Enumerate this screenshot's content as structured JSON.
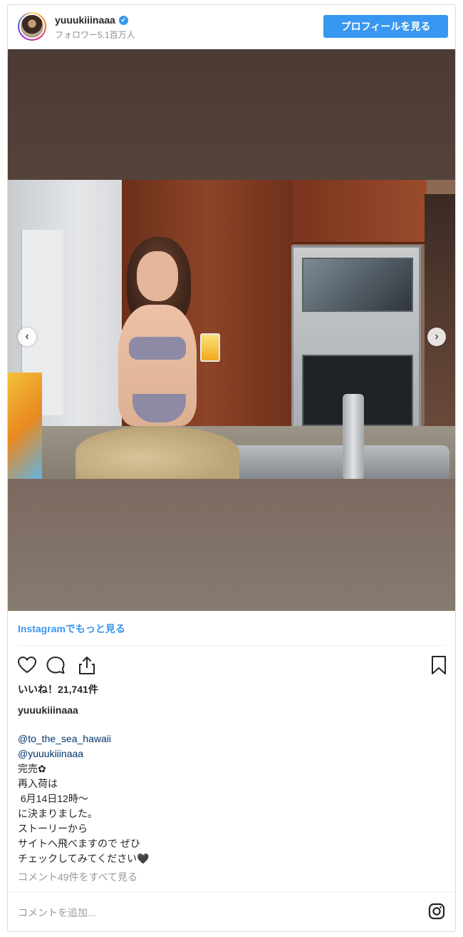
{
  "header": {
    "username": "yuuukiiinaaa",
    "verified_icon": "✔",
    "followers": "フォロワー5.1百万人",
    "profile_button": "プロフィールを見る"
  },
  "media": {
    "prev_arrow": "‹",
    "next_arrow": "›"
  },
  "more_link": "Instagramでもっと見る",
  "likes": "いいね！21,741件",
  "caption": {
    "username": "yuuukiiinaaa",
    "mentions": [
      "@to_the_sea_hawaii",
      "@yuuukiiinaaa"
    ],
    "lines": [
      "完売✿",
      "再入荷は",
      " 6月14日12時〜",
      "に決まりました。",
      "ストーリーから",
      "サイトへ飛べますので ぜひ",
      "チェックしてみてください🖤"
    ]
  },
  "view_comments": "コメント49件をすべて見る",
  "comment_placeholder": "コメントを追加...",
  "colors": {
    "accent": "#3897f0",
    "mention": "#003569",
    "muted": "#999999"
  }
}
